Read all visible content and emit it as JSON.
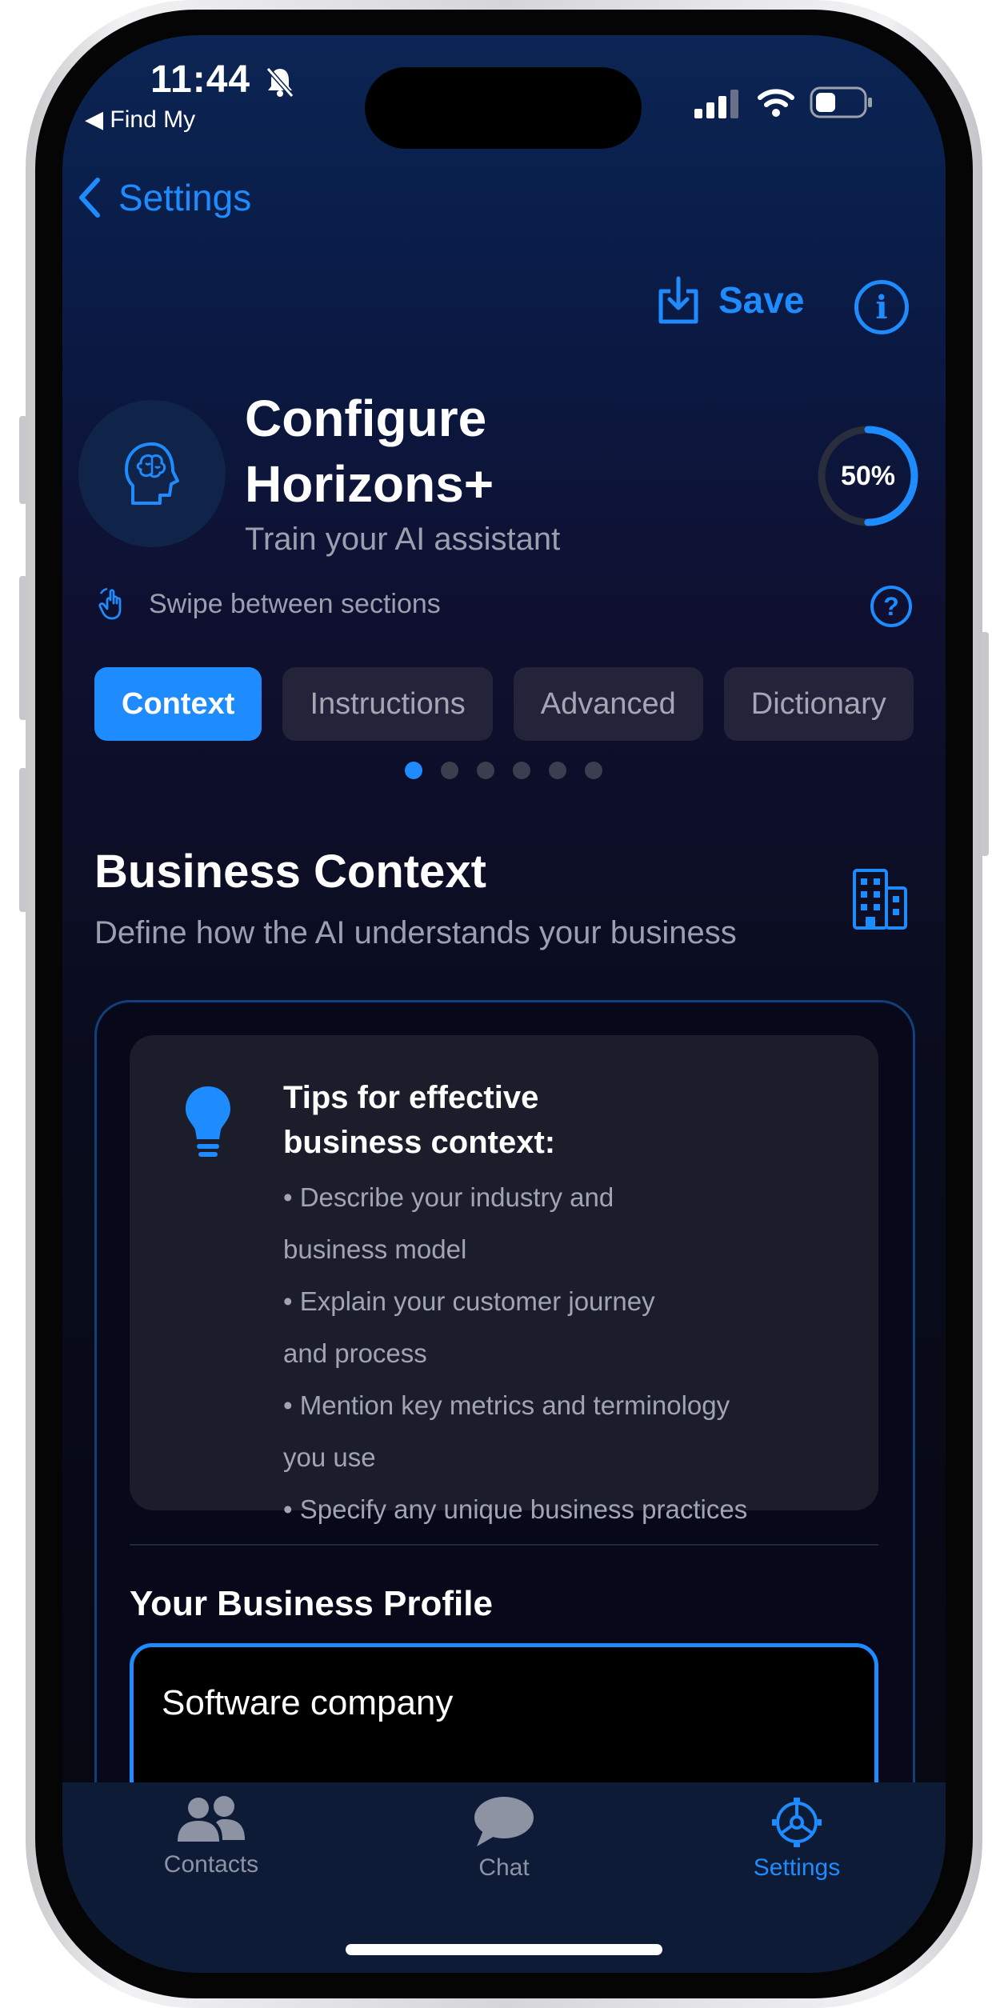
{
  "status": {
    "time": "11:44",
    "back_app": "◀ Find My"
  },
  "nav": {
    "back_label": "Settings",
    "save_label": "Save",
    "info_glyph": "i"
  },
  "header": {
    "title_line1": "Configure",
    "title_line2": "Horizons+",
    "subtitle": "Train your AI assistant",
    "progress_label": "50%",
    "progress_value": 0.5
  },
  "hint": {
    "swipe_text": "Swipe between sections",
    "help_glyph": "?"
  },
  "tabs": [
    {
      "label": "Context",
      "active": true
    },
    {
      "label": "Instructions",
      "active": false
    },
    {
      "label": "Advanced",
      "active": false
    },
    {
      "label": "Dictionary",
      "active": false
    }
  ],
  "pager": {
    "count": 6,
    "active_index": 0
  },
  "section": {
    "title": "Business Context",
    "subtitle": "Define how the AI understands your business"
  },
  "tips": {
    "title_line1": "Tips for effective",
    "title_line2": "business context:",
    "items": [
      {
        "line1": "• Describe your industry and",
        "line2": "business model"
      },
      {
        "line1": "• Explain your customer journey",
        "line2": "and process"
      },
      {
        "line1": "• Mention key metrics and terminology",
        "line2": "you use"
      },
      {
        "line1": "• Specify any unique business practices",
        "line2": ""
      }
    ]
  },
  "profile": {
    "title": "Your Business Profile",
    "value": "Software company"
  },
  "tabbar": {
    "contacts_label": "Contacts",
    "chat_label": "Chat",
    "settings_label": "Settings"
  },
  "colors": {
    "accent": "#1e8bff",
    "background": "#0b1030",
    "card": "#1b1e2a"
  }
}
